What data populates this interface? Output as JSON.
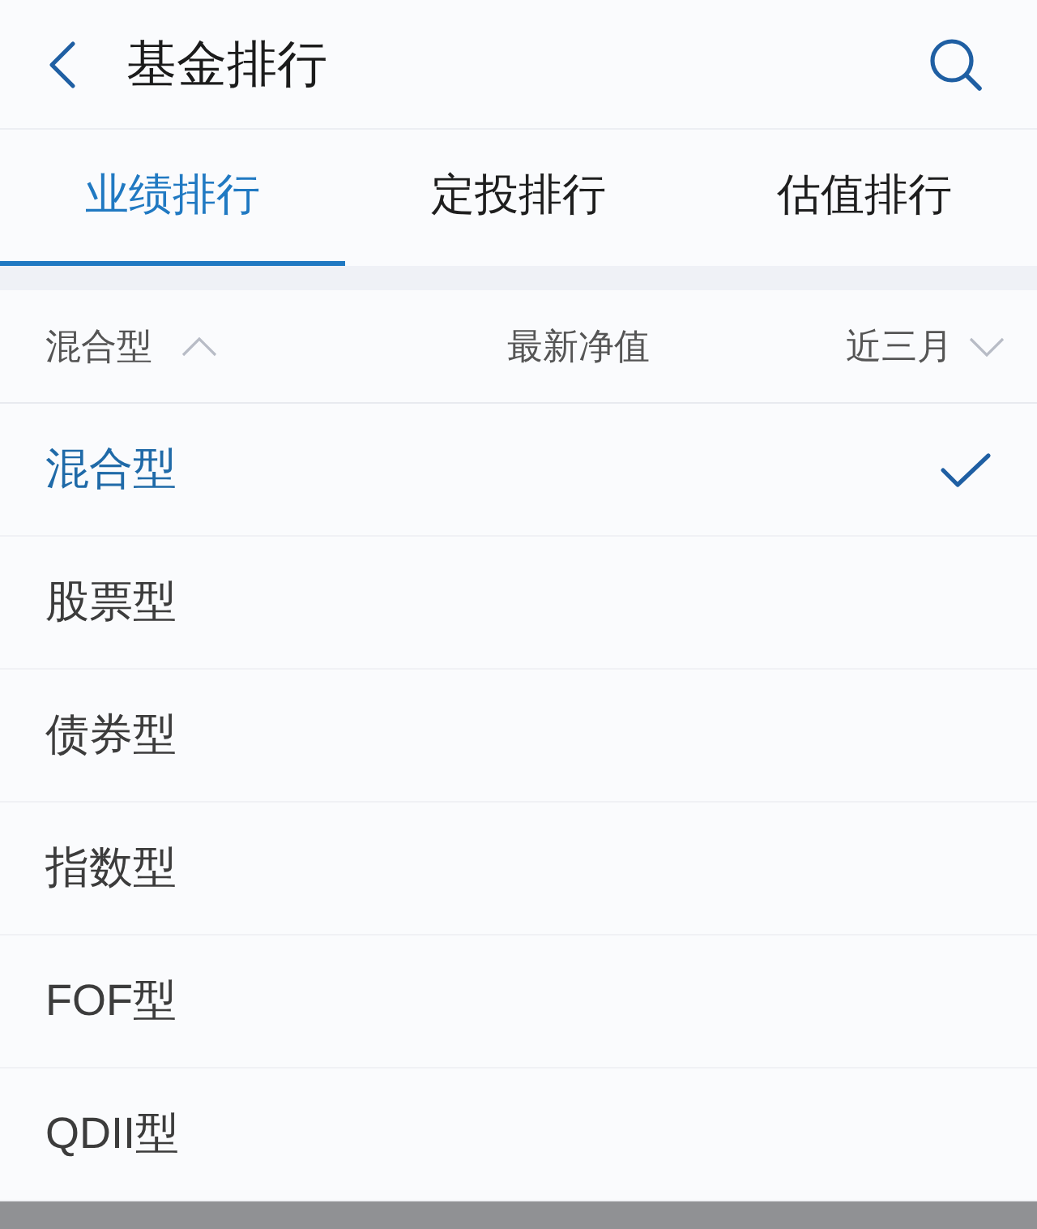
{
  "header": {
    "title": "基金排行"
  },
  "tabs": [
    {
      "label": "业绩排行",
      "selected": true
    },
    {
      "label": "定投排行",
      "selected": false
    },
    {
      "label": "估值排行",
      "selected": false
    }
  ],
  "filter_bar": {
    "category": {
      "label": "混合型",
      "expanded": true
    },
    "column": "最新净值",
    "period": {
      "label": "近三月",
      "expanded": false
    }
  },
  "category_menu": [
    {
      "label": "混合型",
      "selected": true
    },
    {
      "label": "股票型",
      "selected": false
    },
    {
      "label": "债券型",
      "selected": false
    },
    {
      "label": "指数型",
      "selected": false
    },
    {
      "label": "FOF型",
      "selected": false
    },
    {
      "label": "QDII型",
      "selected": false
    }
  ]
}
